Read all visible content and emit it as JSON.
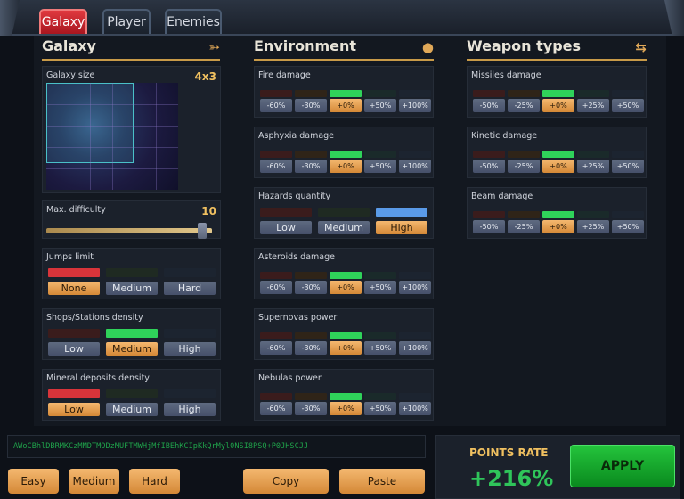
{
  "tabs": [
    {
      "label": "Galaxy"
    },
    {
      "label": "Player"
    },
    {
      "label": "Enemies"
    }
  ],
  "sections": {
    "galaxy": {
      "title": "Galaxy",
      "icon": "galaxy-icon"
    },
    "environment": {
      "title": "Environment",
      "icon": "planet-icon"
    },
    "weapons": {
      "title": "Weapon types",
      "icon": "gun-icon"
    }
  },
  "galaxy": {
    "size_label": "Galaxy size",
    "size_value": "4x3",
    "difficulty_label": "Max. difficulty",
    "difficulty_value": "10",
    "jumps": {
      "label": "Jumps limit",
      "options": [
        "None",
        "Medium",
        "Hard"
      ],
      "selected": "None"
    },
    "shops": {
      "label": "Shops/Stations density",
      "options": [
        "Low",
        "Medium",
        "High"
      ],
      "selected": "Medium"
    },
    "mineral": {
      "label": "Mineral deposits density",
      "options": [
        "Low",
        "Medium",
        "High"
      ],
      "selected": "Low"
    }
  },
  "environment": {
    "fire": {
      "label": "Fire damage",
      "options": [
        "-60%",
        "-30%",
        "+0%",
        "+50%",
        "+100%"
      ],
      "selected": "+0%"
    },
    "asphyxia": {
      "label": "Asphyxia damage",
      "options": [
        "-60%",
        "-30%",
        "+0%",
        "+50%",
        "+100%"
      ],
      "selected": "+0%"
    },
    "hazards": {
      "label": "Hazards quantity",
      "options": [
        "Low",
        "Medium",
        "High"
      ],
      "selected": "High"
    },
    "asteroids": {
      "label": "Asteroids damage",
      "options": [
        "-60%",
        "-30%",
        "+0%",
        "+50%",
        "+100%"
      ],
      "selected": "+0%"
    },
    "supernovas": {
      "label": "Supernovas power",
      "options": [
        "-60%",
        "-30%",
        "+0%",
        "+50%",
        "+100%"
      ],
      "selected": "+0%"
    },
    "nebulas": {
      "label": "Nebulas power",
      "options": [
        "-60%",
        "-30%",
        "+0%",
        "+50%",
        "+100%"
      ],
      "selected": "+0%"
    }
  },
  "weapons": {
    "missiles": {
      "label": "Missiles damage",
      "options": [
        "-50%",
        "-25%",
        "+0%",
        "+25%",
        "+50%"
      ],
      "selected": "+0%"
    },
    "kinetic": {
      "label": "Kinetic damage",
      "options": [
        "-50%",
        "-25%",
        "+0%",
        "+25%",
        "+50%"
      ],
      "selected": "+0%"
    },
    "beam": {
      "label": "Beam damage",
      "options": [
        "-50%",
        "-25%",
        "+0%",
        "+25%",
        "+50%"
      ],
      "selected": "+0%"
    }
  },
  "code": "AWoCBhlDBRMKCzMMDTMODzMUFTMWHjMfIBEhKCIpKkQrMyl0NSI8PSQ+P0JHSCJJ",
  "presets": [
    "Easy",
    "Medium",
    "Hard"
  ],
  "actions": {
    "copy": "Copy",
    "paste": "Paste",
    "apply": "APPLY"
  },
  "points": {
    "label": "POINTS RATE",
    "value": "+216%"
  },
  "colors": {
    "accent": "#d48836",
    "selected_bar": "#2fd35a",
    "tab_active": "#d0262e",
    "points": "#2fc45a"
  }
}
